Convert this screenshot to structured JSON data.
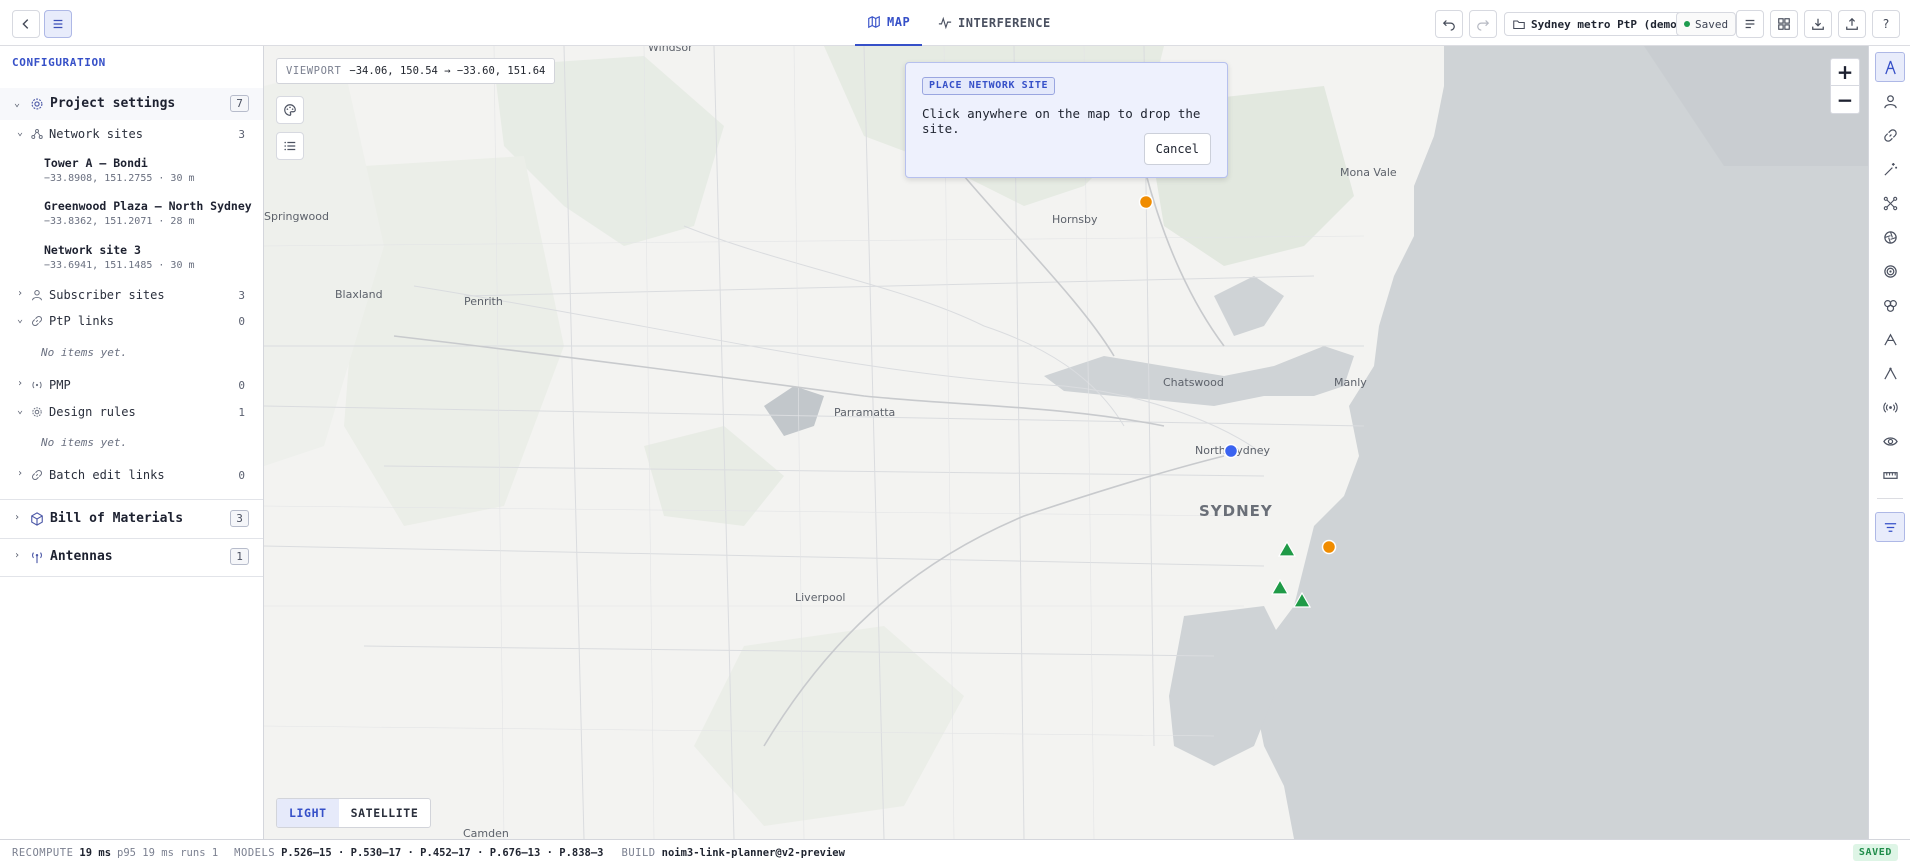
{
  "header": {
    "tabs": [
      {
        "label": "MAP",
        "icon": "map-icon",
        "active": true
      },
      {
        "label": "INTERFERENCE",
        "icon": "activity-icon",
        "active": false
      }
    ],
    "project_name": "Sydney metro PtP (demo)",
    "save_state": "Saved"
  },
  "sidebar": {
    "heading": "CONFIGURATION",
    "project_settings": {
      "title": "Project settings",
      "count": "7",
      "groups": {
        "network_sites": {
          "label": "Network sites",
          "count": "3",
          "items": [
            {
              "name": "Tower A — Bondi",
              "meta": "−33.8908, 151.2755 · 30 m"
            },
            {
              "name": "Greenwood Plaza — North Sydney",
              "meta": "−33.8362, 151.2071 · 28 m"
            },
            {
              "name": "Network site 3",
              "meta": "−33.6941, 151.1485 · 30 m"
            }
          ]
        },
        "subscriber_sites": {
          "label": "Subscriber sites",
          "count": "3"
        },
        "ptp_links": {
          "label": "PtP links",
          "count": "0",
          "empty": "No items yet."
        },
        "pmp": {
          "label": "PMP",
          "count": "0"
        },
        "design_rules": {
          "label": "Design rules",
          "count": "1",
          "empty": "No items yet."
        },
        "batch_edit": {
          "label": "Batch edit links",
          "count": "0"
        }
      }
    },
    "bill_of_materials": {
      "title": "Bill of Materials",
      "count": "3"
    },
    "antennas": {
      "title": "Antennas",
      "count": "1"
    }
  },
  "map": {
    "viewport_label": "VIEWPORT",
    "viewport_value": "−34.06, 150.54 → −33.60, 151.64",
    "place_labels": {
      "windsor": "Windsor",
      "springwood": "Springwood",
      "blaxland": "Blaxland",
      "penrith": "Penrith",
      "hornsby": "Hornsby",
      "mona_vale": "Mona Vale",
      "chatswood": "Chatswood",
      "manly": "Manly",
      "parramatta": "Parramatta",
      "north_sydney": "North Sydney",
      "sydney": "SYDNEY",
      "liverpool": "Liverpool",
      "camden": "Camden"
    },
    "place_panel": {
      "tag": "PLACE NETWORK SITE",
      "message": "Click anywhere on the map to drop the site.",
      "cancel": "Cancel"
    },
    "basemap": {
      "light": "LIGHT",
      "satellite": "SATELLITE",
      "active": "LIGHT"
    },
    "marker_colors": {
      "network_site": "#f08c00",
      "selected_site": "#3b63f0",
      "subscriber": "#1f9a47"
    }
  },
  "status_bar": {
    "recompute_label": "RECOMPUTE",
    "recompute_value": "19 ms",
    "recompute_extra": "p95 19 ms runs 1",
    "models_label": "MODELS",
    "models_value": "P.526–15 · P.530–17 · P.452–17 · P.676–13 · P.838–3",
    "build_label": "BUILD",
    "build_value": "noim3-link-planner@v2-preview",
    "saved_badge": "SAVED"
  }
}
